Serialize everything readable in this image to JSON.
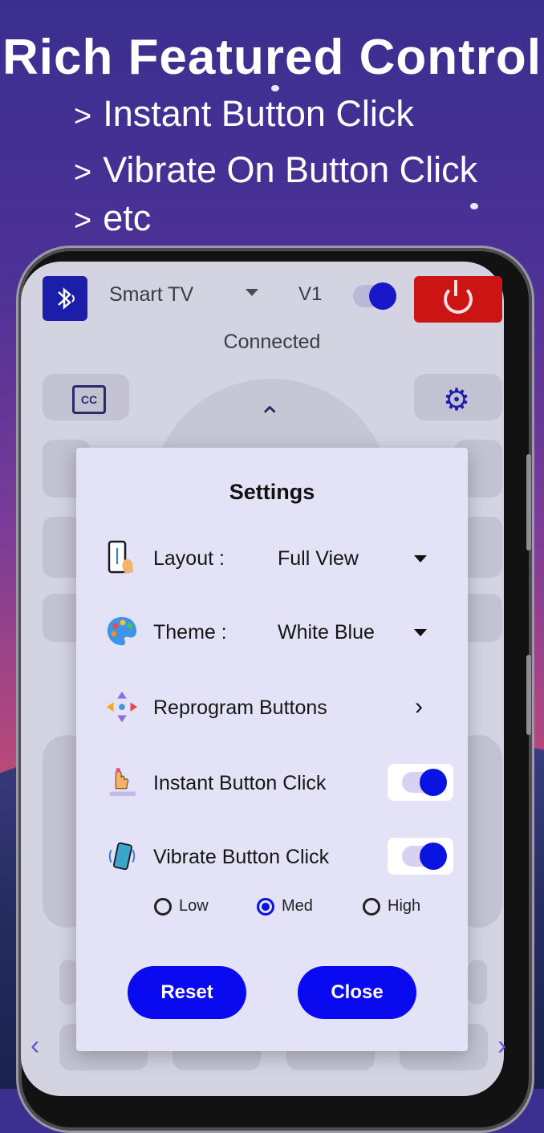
{
  "promo": {
    "title": "Rich Featured Control",
    "lines": [
      "Instant Button Click",
      "Vibrate On Button Click",
      "etc"
    ]
  },
  "remote": {
    "device_name": "Smart TV",
    "version": "V1",
    "status": "Connected",
    "cc_label": "CC"
  },
  "settings": {
    "title": "Settings",
    "layout_label": "Layout :",
    "layout_value": "Full View",
    "theme_label": "Theme :",
    "theme_value": "White Blue",
    "reprogram_label": "Reprogram Buttons",
    "instant_label": "Instant Button Click",
    "instant_on": true,
    "vibrate_label": "Vibrate Button Click",
    "vibrate_on": true,
    "vibration_levels": [
      "Low",
      "Med",
      "High"
    ],
    "vibration_selected": "Med",
    "reset_label": "Reset",
    "close_label": "Close"
  },
  "icons": [
    "bluetooth-icon",
    "power-icon",
    "cc-icon",
    "gear-icon",
    "phone-icon",
    "palette-icon",
    "move-arrows-icon",
    "tap-icon",
    "vibrate-icon",
    "chevron-right-icon",
    "dropdown-caret-icon"
  ],
  "colors": {
    "accent": "#0a0af0",
    "power": "#cc1414",
    "dialog_bg": "#e3e2f6"
  }
}
